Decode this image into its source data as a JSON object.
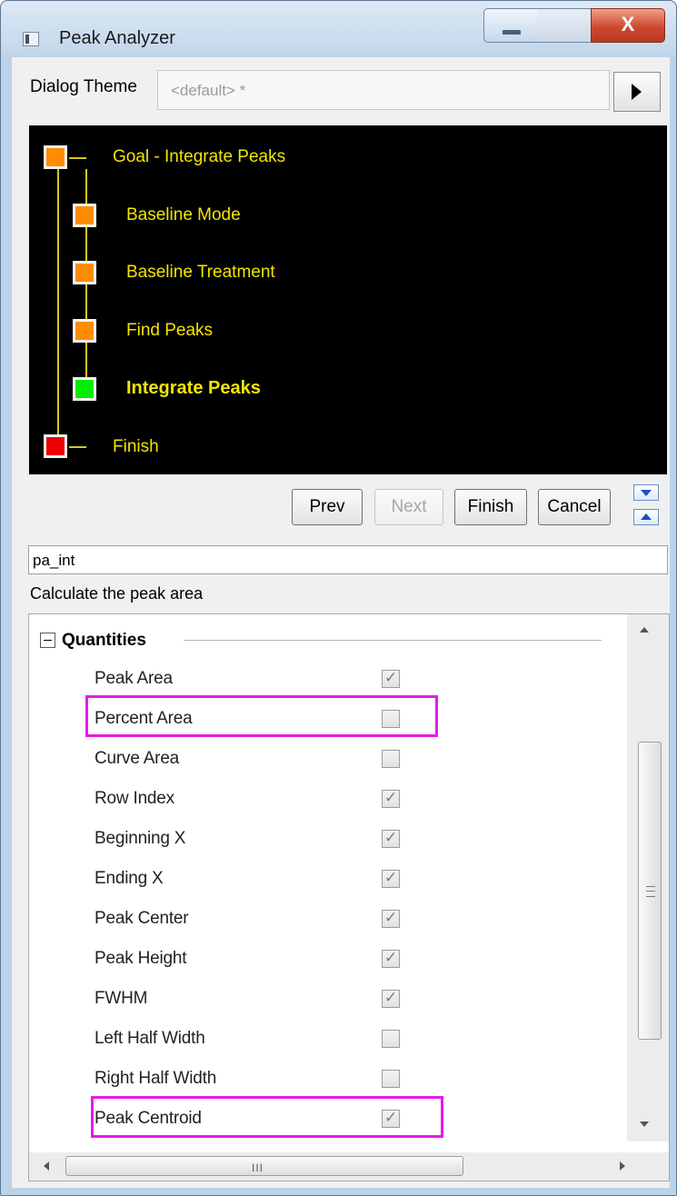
{
  "window": {
    "title": "Peak Analyzer",
    "close_glyph": "X"
  },
  "theme": {
    "label": "Dialog Theme",
    "value": "<default> *"
  },
  "tree": {
    "items": [
      {
        "label": "Goal - Integrate Peaks",
        "status": "orange"
      },
      {
        "label": "Baseline Mode",
        "status": "orange"
      },
      {
        "label": "Baseline Treatment",
        "status": "orange"
      },
      {
        "label": "Find Peaks",
        "status": "orange"
      },
      {
        "label": "Integrate Peaks",
        "status": "green",
        "current": true
      },
      {
        "label": "Finish",
        "status": "red"
      }
    ]
  },
  "buttons": {
    "prev": "Prev",
    "next": "Next",
    "finish": "Finish",
    "cancel": "Cancel"
  },
  "page": {
    "name": "pa_int",
    "description": "Calculate the peak area"
  },
  "quantities": {
    "title": "Quantities",
    "items": [
      {
        "label": "Peak Area",
        "checked": true
      },
      {
        "label": "Percent Area",
        "checked": false,
        "highlighted": true
      },
      {
        "label": "Curve Area",
        "checked": false
      },
      {
        "label": "Row Index",
        "checked": true
      },
      {
        "label": "Beginning X",
        "checked": true
      },
      {
        "label": "Ending X",
        "checked": true
      },
      {
        "label": "Peak Center",
        "checked": true
      },
      {
        "label": "Peak Height",
        "checked": true
      },
      {
        "label": "FWHM",
        "checked": true
      },
      {
        "label": "Left Half Width",
        "checked": false
      },
      {
        "label": "Right Half Width",
        "checked": false
      },
      {
        "label": "Peak Centroid",
        "checked": true,
        "highlighted": true
      }
    ]
  },
  "scrollbar": {
    "grip": "≡",
    "hgrip": "III"
  },
  "colors": {
    "highlight": "#e61be6",
    "tree_text": "#f2e600",
    "node_orange": "#ff8c00",
    "node_green": "#00ee00",
    "node_red": "#ee0000"
  }
}
